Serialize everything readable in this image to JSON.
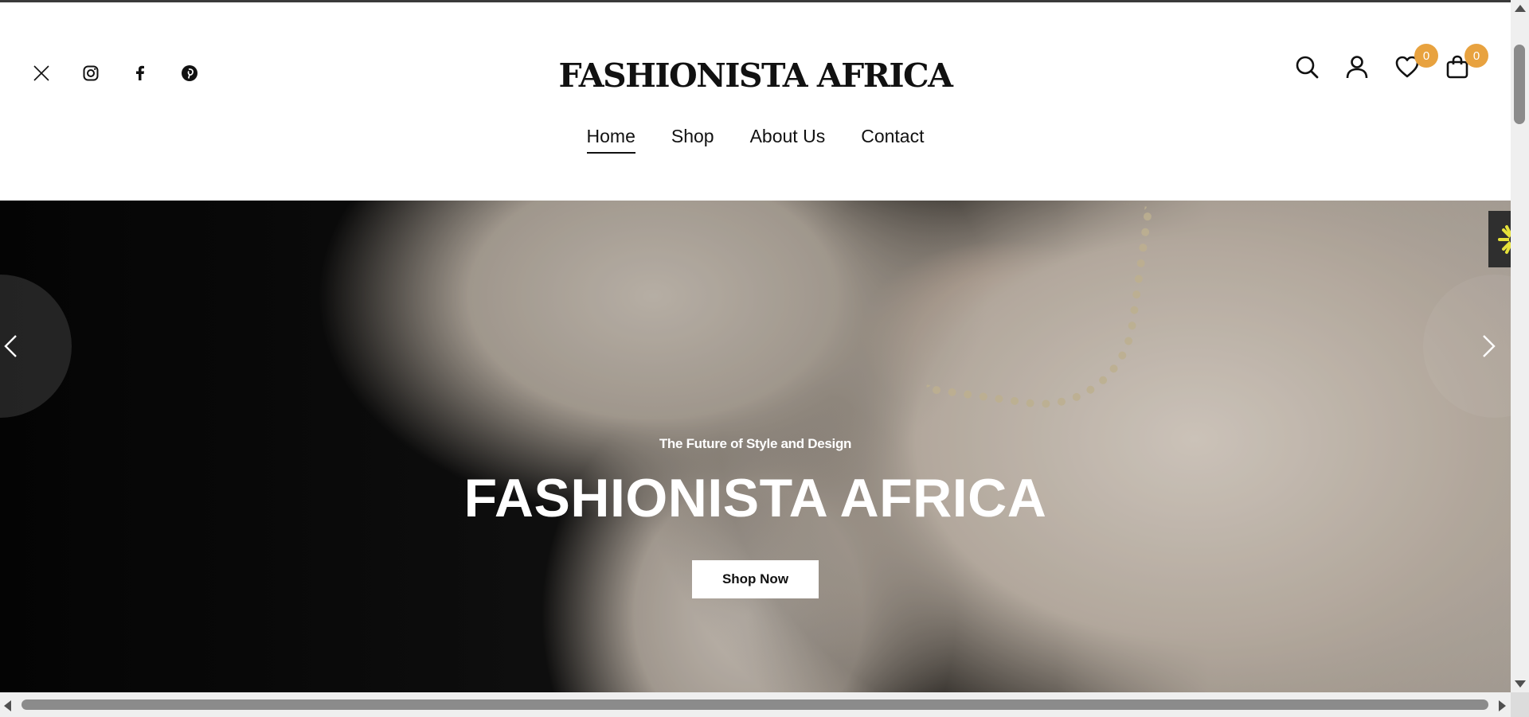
{
  "header": {
    "logo": "FASHIONISTA AFRICA",
    "social": [
      "x-twitter-icon",
      "instagram-icon",
      "facebook-icon",
      "pinterest-icon"
    ],
    "nav": [
      {
        "label": "Home",
        "active": true
      },
      {
        "label": "Shop",
        "active": false
      },
      {
        "label": "About Us",
        "active": false
      },
      {
        "label": "Contact",
        "active": false
      }
    ],
    "icons": [
      "search-icon",
      "user-icon",
      "heart-icon",
      "bag-icon"
    ],
    "wishlist_count": "0",
    "cart_count": "0",
    "badge_color": "#e8a23f"
  },
  "hero": {
    "subtitle": "The Future of Style and Design",
    "title": "FASHIONISTA AFRICA",
    "button_label": "Shop Now",
    "prev_icon": "chevron-left-icon",
    "next_icon": "chevron-right-icon"
  },
  "widget": {
    "icon": "asterisk-badge-icon",
    "color": "#e6e23a"
  }
}
